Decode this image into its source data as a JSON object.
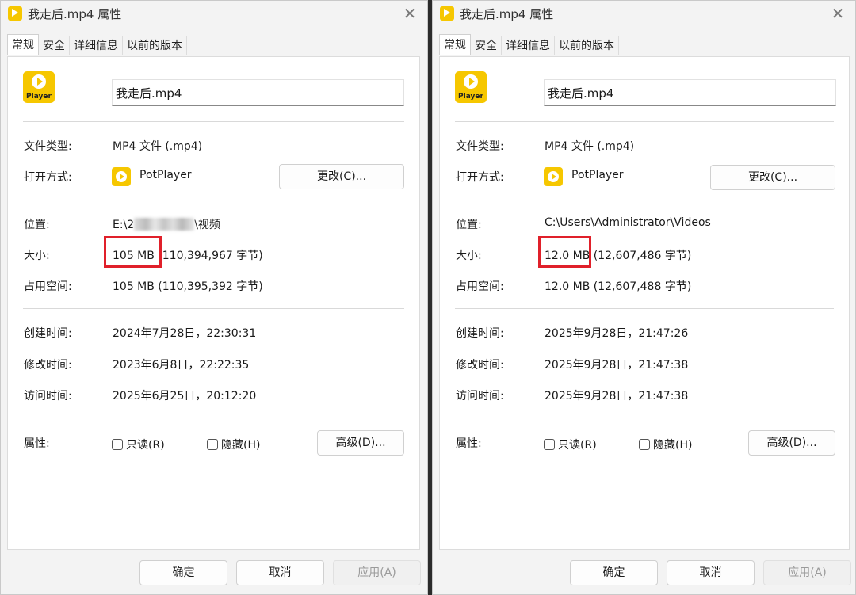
{
  "left": {
    "title": "我走后.mp4 属性",
    "tabs": [
      "常规",
      "安全",
      "详细信息",
      "以前的版本"
    ],
    "icon_label": "Player",
    "filename": "我走后.mp4",
    "rows": {
      "type_label": "文件类型:",
      "type_value": "MP4 文件 (.mp4)",
      "open_label": "打开方式:",
      "open_app": "PotPlayer",
      "change_button": "更改(C)...",
      "location_label": "位置:",
      "location_prefix": "E:\\2",
      "location_suffix": "\\视频",
      "size_label": "大小:",
      "size_main": "105 MB",
      "size_bytes": "(110,394,967 字节)",
      "disk_label": "占用空间:",
      "disk_value": "105 MB (110,395,392 字节)",
      "created_label": "创建时间:",
      "created_value": "2024年7月28日，22:30:31",
      "modified_label": "修改时间:",
      "modified_value": "2023年6月8日，22:22:35",
      "accessed_label": "访问时间:",
      "accessed_value": "2025年6月25日，20:12:20",
      "attr_label": "属性:",
      "readonly_label": "只读(R)",
      "hidden_label": "隐藏(H)",
      "advanced_button": "高级(D)..."
    },
    "footer": {
      "ok": "确定",
      "cancel": "取消",
      "apply": "应用(A)"
    }
  },
  "right": {
    "title": "我走后.mp4 属性",
    "tabs": [
      "常规",
      "安全",
      "详细信息",
      "以前的版本"
    ],
    "icon_label": "Player",
    "filename": "我走后.mp4",
    "rows": {
      "type_label": "文件类型:",
      "type_value": "MP4 文件 (.mp4)",
      "open_label": "打开方式:",
      "open_app": "PotPlayer",
      "change_button": "更改(C)...",
      "location_label": "位置:",
      "location_value": "C:\\Users\\Administrator\\Videos",
      "size_label": "大小:",
      "size_main": "12.0 MB",
      "size_bytes": "(12,607,486 字节)",
      "disk_label": "占用空间:",
      "disk_value": "12.0 MB (12,607,488 字节)",
      "created_label": "创建时间:",
      "created_value": "2025年9月28日，21:47:26",
      "modified_label": "修改时间:",
      "modified_value": "2025年9月28日，21:47:38",
      "accessed_label": "访问时间:",
      "accessed_value": "2025年9月28日，21:47:38",
      "attr_label": "属性:",
      "readonly_label": "只读(R)",
      "hidden_label": "隐藏(H)",
      "advanced_button": "高级(D)..."
    },
    "footer": {
      "ok": "确定",
      "cancel": "取消",
      "apply": "应用(A)"
    }
  },
  "colors": {
    "accent_highlight": "#e0202a",
    "app_icon": "#f6c700"
  },
  "icons": {
    "app": "potplayer-icon",
    "close": "close-icon",
    "checkbox": "checkbox-icon"
  }
}
